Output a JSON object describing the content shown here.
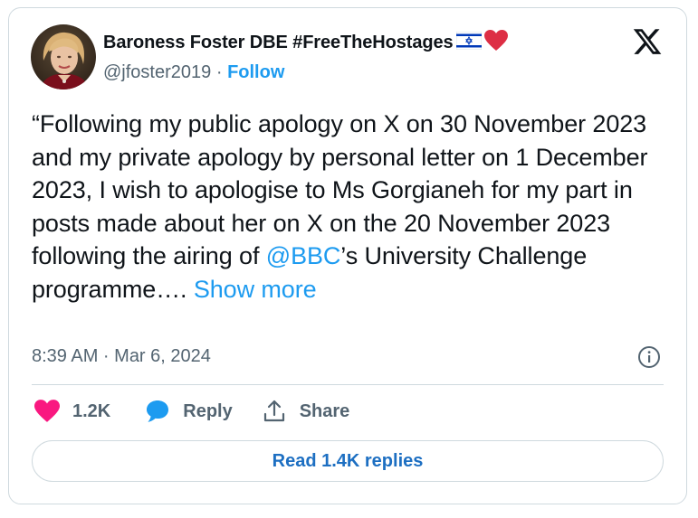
{
  "author": {
    "display_name": "Baroness Foster DBE #FreeTheHostages",
    "handle": "@jfoster2019",
    "separator": "·",
    "follow_label": "Follow"
  },
  "tweet": {
    "text_before_mention": "“Following my public apology on X on 30 November 2023 and my private apology by personal letter on 1 December 2023, I wish to apologise to Ms Gorgianeh for my part in posts made about her on X on the 20 November 2023 following the airing of ",
    "mention": "@BBC",
    "text_after_mention": "’s University Challenge programme…. ",
    "show_more_label": "Show more",
    "timestamp": "8:39 AM · Mar 6, 2024"
  },
  "actions": {
    "like_count": "1.2K",
    "reply_label": "Reply",
    "share_label": "Share"
  },
  "read_replies_label": "Read 1.4K replies",
  "icons": {
    "logo": "x-logo-icon",
    "info": "info-icon",
    "like": "heart-icon",
    "reply": "speech-bubble-icon",
    "share": "share-icon",
    "flag": "israel-flag-icon",
    "heart_emoji": "red-heart-icon"
  },
  "colors": {
    "accent": "#1d9bf0",
    "like": "#f91880",
    "text": "#0f1419",
    "muted": "#536471",
    "border": "#cfd9de",
    "heart_emoji": "#dd2e44",
    "flag_blue": "#0038b8"
  }
}
